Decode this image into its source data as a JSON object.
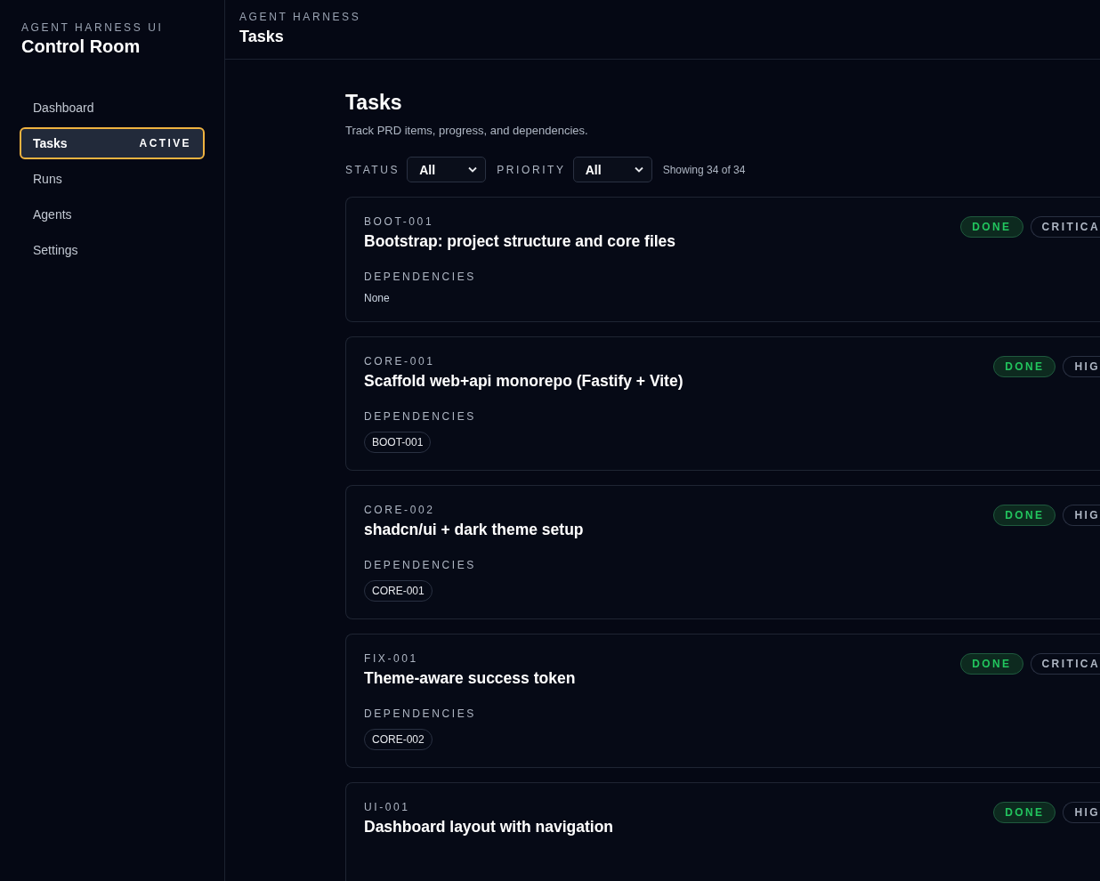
{
  "sidebar": {
    "eyebrow": "AGENT HARNESS UI",
    "title": "Control Room",
    "items": [
      {
        "label": "Dashboard",
        "selected": false
      },
      {
        "label": "Tasks",
        "selected": true,
        "badge": "ACTIVE"
      },
      {
        "label": "Runs",
        "selected": false
      },
      {
        "label": "Agents",
        "selected": false
      },
      {
        "label": "Settings",
        "selected": false
      }
    ]
  },
  "header": {
    "eyebrow": "AGENT HARNESS",
    "title": "Tasks"
  },
  "page": {
    "title": "Tasks",
    "subtitle": "Track PRD items, progress, and dependencies."
  },
  "filters": [
    {
      "label": "STATUS",
      "value": "All"
    },
    {
      "label": "PRIORITY",
      "value": "All"
    }
  ],
  "count": "Showing 34 of 34",
  "tasks": [
    {
      "id": "BOOT-001",
      "title": "Bootstrap: project structure and core files",
      "status": "DONE",
      "priority": "CRITICA",
      "dependencies_label": "DEPENDENCIES",
      "none_text": "None"
    },
    {
      "id": "CORE-001",
      "title": "Scaffold web+api monorepo (Fastify + Vite)",
      "status": "DONE",
      "priority": "HIG",
      "dependencies_label": "DEPENDENCIES",
      "dependencies": [
        "BOOT-001"
      ]
    },
    {
      "id": "CORE-002",
      "title": "shadcn/ui + dark theme setup",
      "status": "DONE",
      "priority": "HIG",
      "dependencies_label": "DEPENDENCIES",
      "dependencies": [
        "CORE-001"
      ]
    },
    {
      "id": "FIX-001",
      "title": "Theme-aware success token",
      "status": "DONE",
      "priority": "CRITICA",
      "dependencies_label": "DEPENDENCIES",
      "dependencies": [
        "CORE-002"
      ]
    },
    {
      "id": "UI-001",
      "title": "Dashboard layout with navigation",
      "status": "DONE",
      "priority": "HIG"
    }
  ]
}
